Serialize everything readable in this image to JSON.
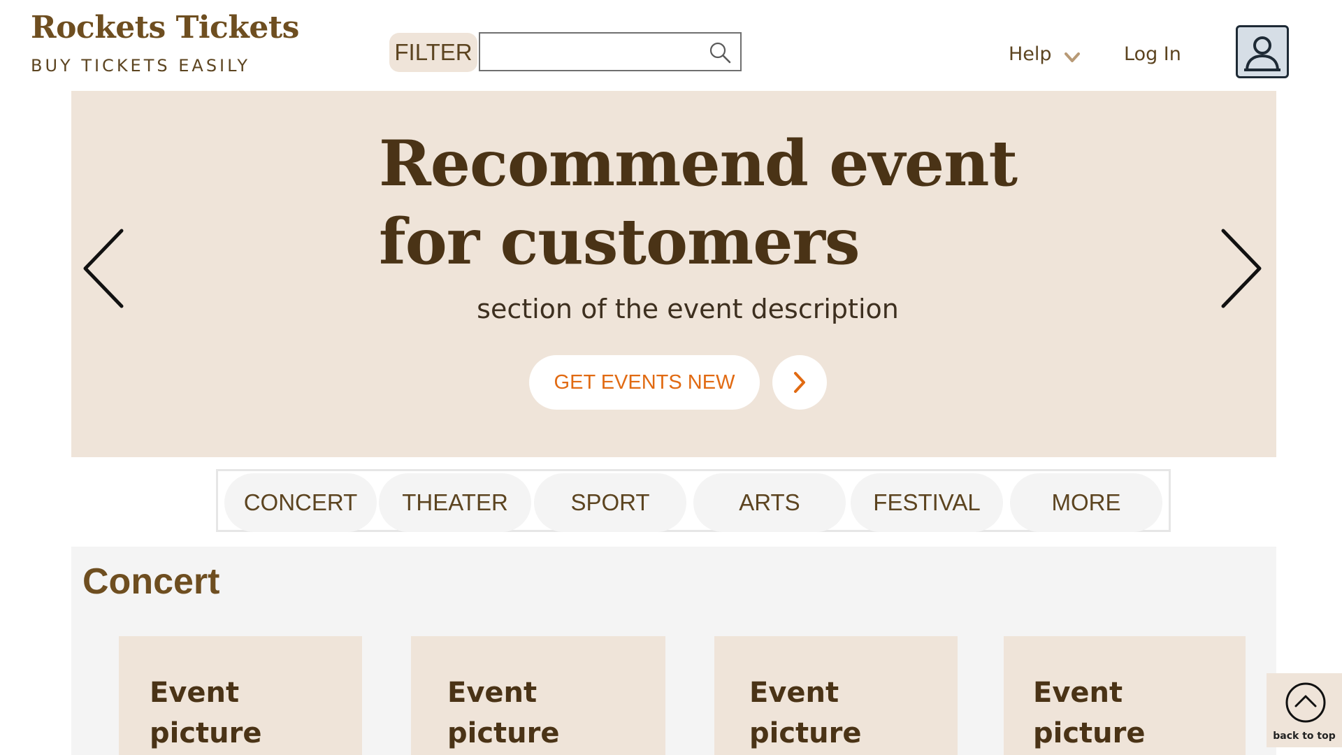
{
  "brand": {
    "title": "Rockets Tickets",
    "tagline": "BUY TICKETS EASILY"
  },
  "header": {
    "filter_label": "FILTER",
    "search_placeholder": "",
    "search_value": "",
    "help_label": "Help",
    "login_label": "Log In"
  },
  "hero": {
    "title": "Recommend  event for customers",
    "subtitle": "section of the event description",
    "cta_label": "GET EVENTS NEW"
  },
  "categories": [
    "CONCERT",
    "THEATER",
    "SPORT",
    "ARTS",
    "FESTIVAL",
    "MORE"
  ],
  "section": {
    "title": "Concert",
    "cards": [
      {
        "label": "Event picture"
      },
      {
        "label": "Event picture"
      },
      {
        "label": "Event picture"
      },
      {
        "label": "Event picture"
      }
    ]
  },
  "back_to_top_label": "back to top",
  "colors": {
    "brand_brown": "#6e4e20",
    "hero_bg": "#efe4d9",
    "accent_orange": "#e16a12",
    "section_bg": "#f4f4f4"
  }
}
